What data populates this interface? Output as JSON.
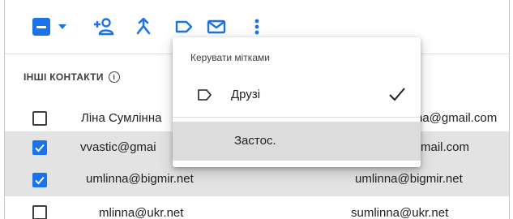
{
  "toolbar": {
    "icons": [
      "select-all-checkbox",
      "chevron-down-icon",
      "add-person-icon",
      "merge-icon",
      "label-icon",
      "mail-icon",
      "more-vert-icon"
    ]
  },
  "section": {
    "title": "ІНШІ КОНТАКТИ",
    "info_glyph": "i"
  },
  "contacts": [
    {
      "name": "Ліна Сумлінна",
      "email": "lina.sumlinna@gmail.com",
      "visible_email": "na@gmail.com",
      "checked": false
    },
    {
      "name": "vvastic@gmail.com",
      "email": "vvastic@gmail.com",
      "visible_name": "vvastic@gmai",
      "visible_email": "mail.com",
      "checked": true
    },
    {
      "name": "umlinna@bigmir.net",
      "email": "umlinna@bigmir.net",
      "checked": true
    },
    {
      "name": "mlinna@ukr.net",
      "email": "sumlinna@ukr.net",
      "checked": false
    }
  ],
  "menu": {
    "title": "Керувати мітками",
    "items": [
      {
        "label": "Друзі",
        "checked": true
      }
    ],
    "apply_label": "Застос."
  },
  "colors": {
    "accent": "#1a73e8",
    "selected_row": "#e3e3e3"
  }
}
